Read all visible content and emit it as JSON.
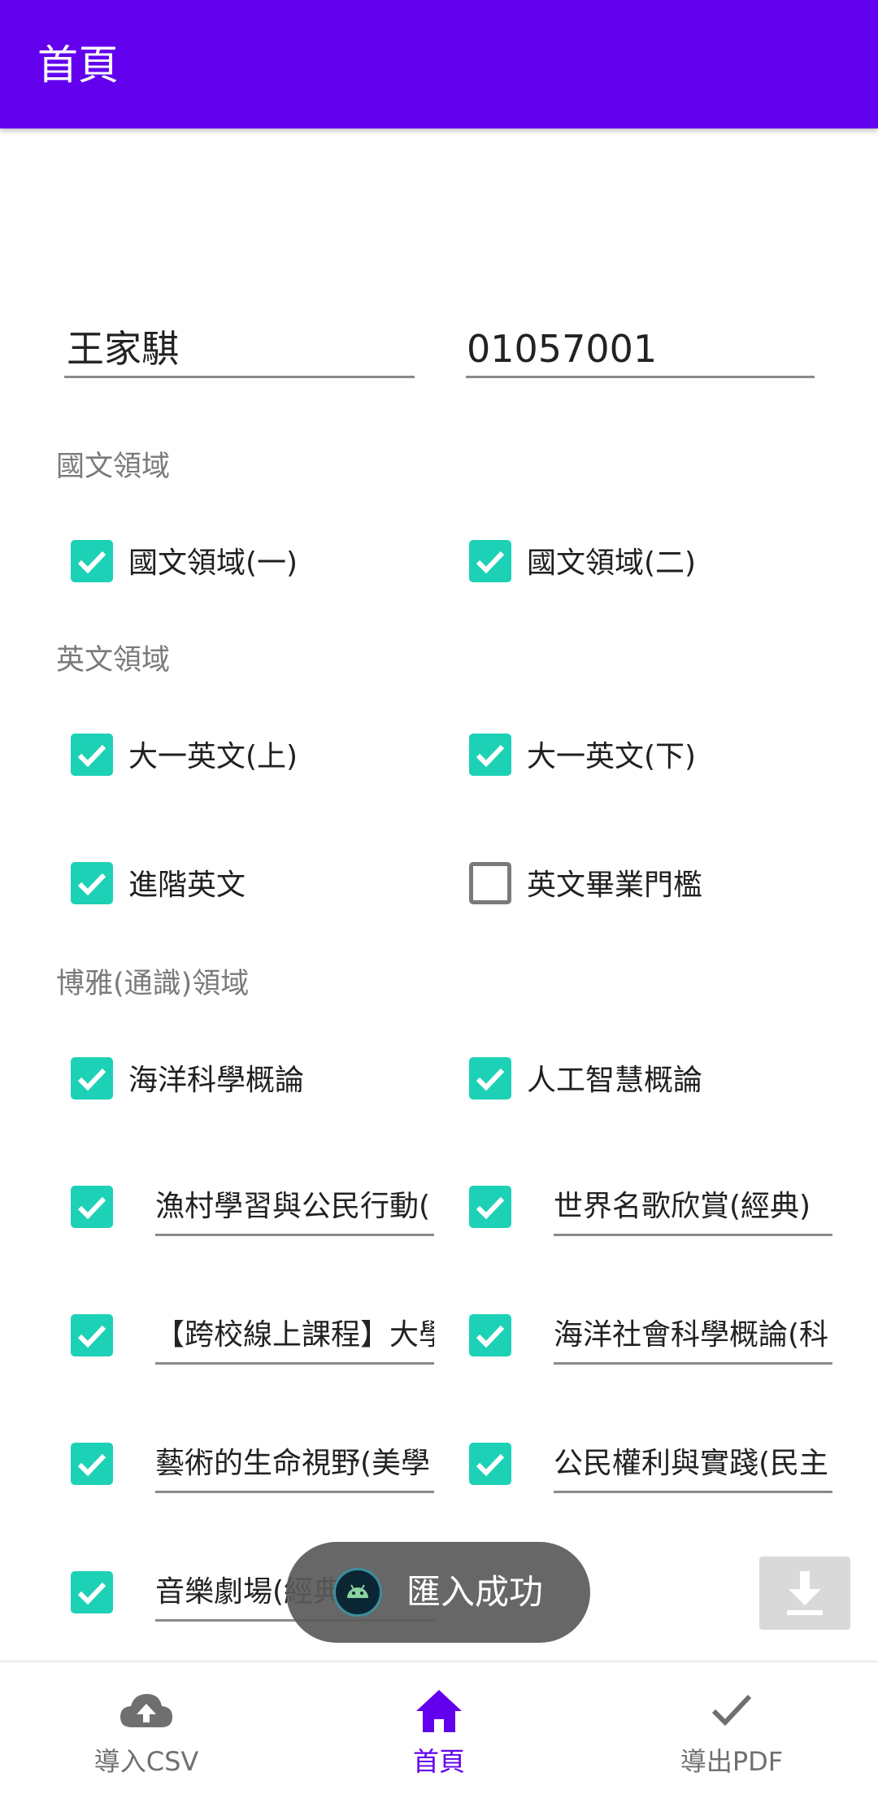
{
  "app_bar": {
    "title": "首頁"
  },
  "student": {
    "name": "王家騏",
    "id": "01057001"
  },
  "sections": {
    "chinese": "國文領域",
    "english": "英文領域",
    "liberal": "博雅(通識)領域"
  },
  "courses": {
    "chinese_1": {
      "label": "國文領域(一)",
      "checked": true
    },
    "chinese_2": {
      "label": "國文領域(二)",
      "checked": true
    },
    "english_1": {
      "label": "大一英文(上)",
      "checked": true
    },
    "english_2": {
      "label": "大一英文(下)",
      "checked": true
    },
    "english_adv": {
      "label": "進階英文",
      "checked": true
    },
    "english_grad": {
      "label": "英文畢業門檻",
      "checked": false
    },
    "ocean_sci": {
      "label": "海洋科學概論",
      "checked": true
    },
    "ai_intro": {
      "label": "人工智慧概論",
      "checked": true
    }
  },
  "elective_fields": [
    {
      "value": "漁村學習與公民行動(",
      "checked": true
    },
    {
      "value": "世界名歌欣賞(經典)",
      "checked": true
    },
    {
      "value": "【跨校線上課程】大學",
      "checked": true
    },
    {
      "value": "海洋社會科學概論(科",
      "checked": true
    },
    {
      "value": "藝術的生命視野(美學",
      "checked": true
    },
    {
      "value": "公民權利與實踐(民主",
      "checked": true
    },
    {
      "value": "音樂劇場(經典",
      "checked": true
    }
  ],
  "toast": {
    "message": "匯入成功"
  },
  "bottom_nav": {
    "import": "導入CSV",
    "home": "首頁",
    "export": "導出PDF"
  },
  "colors": {
    "primary": "#6200ee",
    "checkbox": "#1dd1b6"
  }
}
